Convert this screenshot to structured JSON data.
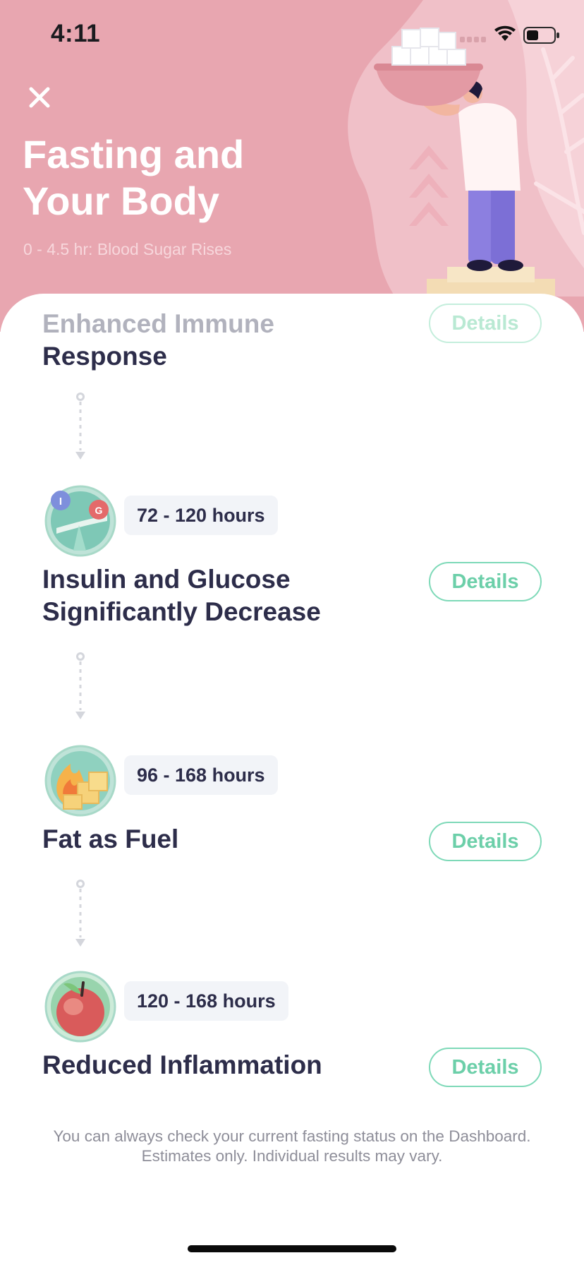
{
  "status_bar": {
    "time": "4:11"
  },
  "header": {
    "title": "Fasting and Your Body",
    "subtitle": "0 - 4.5 hr: Blood Sugar Rises"
  },
  "stages": [
    {
      "name": "Enhanced Immune Response",
      "hours": "",
      "details_label": "Details",
      "icon": "immune-icon"
    },
    {
      "name": "Insulin and Glucose Significantly Decrease",
      "hours": "72 - 120 hours",
      "details_label": "Details",
      "icon": "insulin-glucose-seesaw-icon"
    },
    {
      "name": "Fat as Fuel",
      "hours": "96 - 168 hours",
      "details_label": "Details",
      "icon": "fat-fuel-flame-icon"
    },
    {
      "name": "Reduced Inflammation",
      "hours": "120 - 168 hours",
      "details_label": "Details",
      "icon": "apple-icon"
    }
  ],
  "footer": {
    "line1": "You can always check your current fasting status on the Dashboard.",
    "line2": "Estimates only. Individual results may vary."
  },
  "colors": {
    "header_bg": "#e8a6b0",
    "accent_green": "#6ccfa9",
    "title_dark": "#2d2d4a",
    "pill_bg": "#f2f4f8"
  }
}
